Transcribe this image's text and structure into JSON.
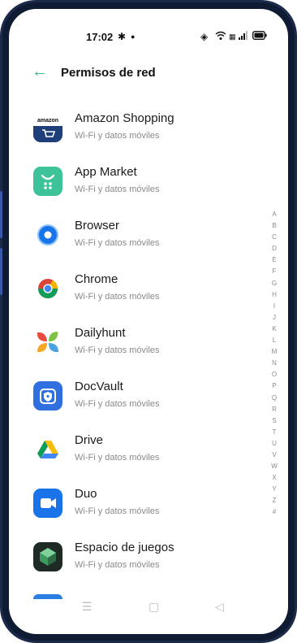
{
  "status_bar": {
    "time": "17:02",
    "icons": [
      "gear-icon",
      "dot-icon",
      "hotspot-icon",
      "wifi-icon",
      "sim-icon",
      "signal-icon",
      "battery-icon"
    ]
  },
  "header": {
    "title": "Permisos de red"
  },
  "apps": [
    {
      "name": "Amazon Shopping",
      "permission": "Wi-Fi y datos móviles",
      "icon": "amazon-shopping-icon",
      "icon_text": "amazon"
    },
    {
      "name": "App Market",
      "permission": "Wi-Fi y datos móviles",
      "icon": "app-market-icon"
    },
    {
      "name": "Browser",
      "permission": "Wi-Fi y datos móviles",
      "icon": "browser-icon"
    },
    {
      "name": "Chrome",
      "permission": "Wi-Fi y datos móviles",
      "icon": "chrome-icon"
    },
    {
      "name": "Dailyhunt",
      "permission": "Wi-Fi y datos móviles",
      "icon": "dailyhunt-icon"
    },
    {
      "name": "DocVault",
      "permission": "Wi-Fi y datos móviles",
      "icon": "docvault-icon"
    },
    {
      "name": "Drive",
      "permission": "Wi-Fi y datos móviles",
      "icon": "drive-icon"
    },
    {
      "name": "Duo",
      "permission": "Wi-Fi y datos móviles",
      "icon": "duo-icon"
    },
    {
      "name": "Espacio de juegos",
      "permission": "Wi-Fi y datos móviles",
      "icon": "espacio-de-juegos-icon"
    }
  ],
  "alphabet": [
    "A",
    "B",
    "C",
    "D",
    "E",
    "F",
    "G",
    "H",
    "I",
    "J",
    "K",
    "L",
    "M",
    "N",
    "O",
    "P",
    "Q",
    "R",
    "S",
    "T",
    "U",
    "V",
    "W",
    "X",
    "Y",
    "Z",
    "#"
  ],
  "colors": {
    "accent": "#2fb88b",
    "title": "#111111",
    "subtitle": "#8a8a8a"
  }
}
